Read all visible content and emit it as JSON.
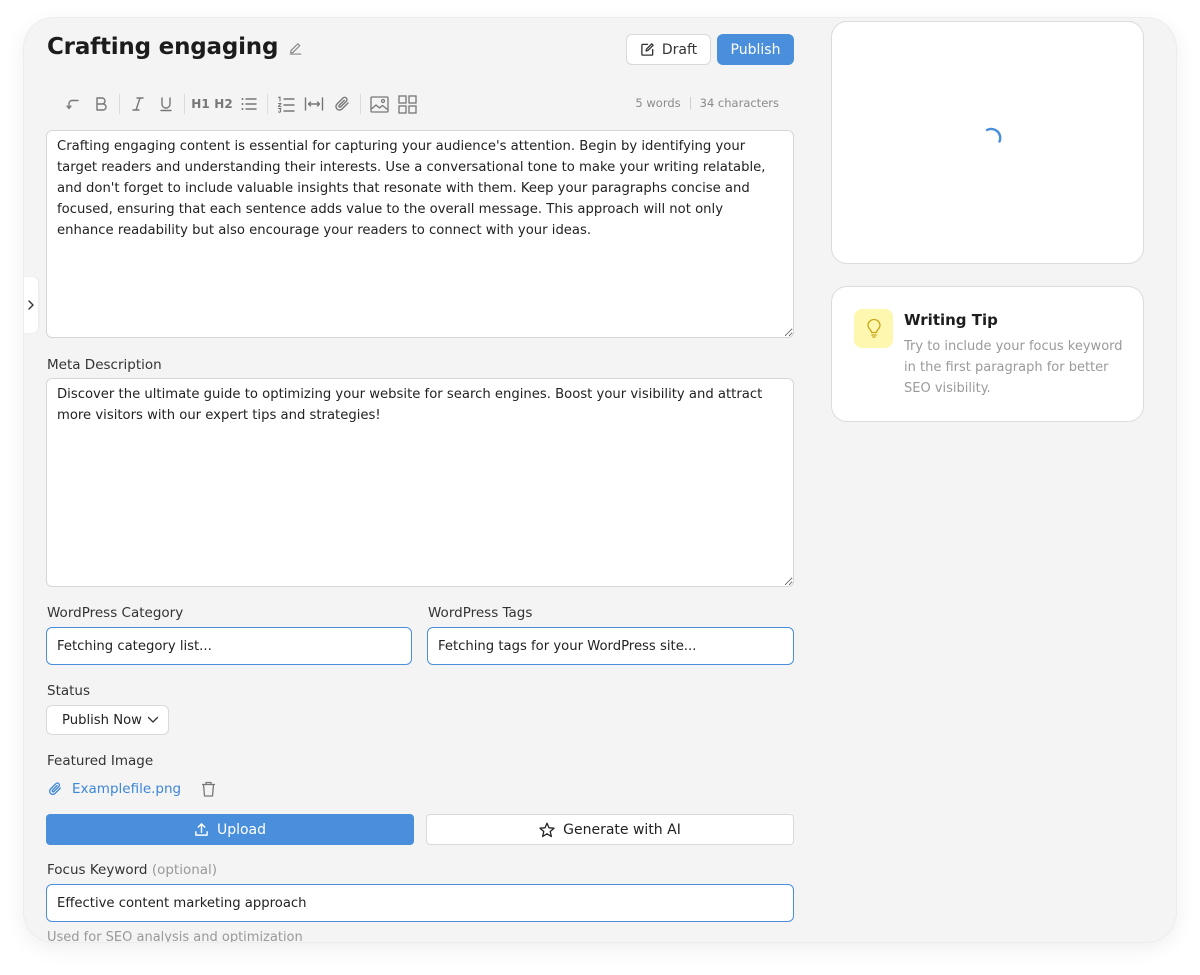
{
  "header": {
    "title": "Crafting engaging",
    "draft_label": "Draft",
    "publish_label": "Publish"
  },
  "toolbar": {
    "h1_label": "H1",
    "h2_label": "H2",
    "words": "5 words",
    "characters": "34 characters"
  },
  "editor": {
    "content": "Crafting engaging content is essential for capturing your audience's attention. Begin by identifying your target readers and understanding their interests. Use a conversational tone to make your writing relatable, and don't forget to include valuable insights that resonate with them. Keep your paragraphs concise and focused, ensuring that each sentence adds value to the overall message. This approach will not only enhance readability but also encourage your readers to connect with your ideas."
  },
  "meta": {
    "label": "Meta Description",
    "value": "Discover the ultimate guide to optimizing your website for search engines. Boost your visibility and attract more visitors with our expert tips and strategies!"
  },
  "category": {
    "label": "WordPress Category",
    "value": "Fetching category list..."
  },
  "tags": {
    "label": "WordPress Tags",
    "value": "Fetching tags for your WordPress site..."
  },
  "status": {
    "label": "Status",
    "selected": "Publish Now"
  },
  "featured_image": {
    "label": "Featured Image",
    "filename": "Examplefile.png",
    "upload_label": "Upload",
    "generate_label": "Generate with AI"
  },
  "focus_keyword": {
    "label": "Focus Keyword",
    "optional": "(optional)",
    "value": "Effective content marketing approach",
    "help": "Used for SEO analysis and optimization"
  },
  "tip": {
    "title": "Writing Tip",
    "text": "Try to include your focus keyword in the first paragraph for better SEO visibility."
  },
  "colors": {
    "accent": "#4a8fdb",
    "tip_icon_bg": "#fdf7b0",
    "background": "#f4f4f4"
  }
}
